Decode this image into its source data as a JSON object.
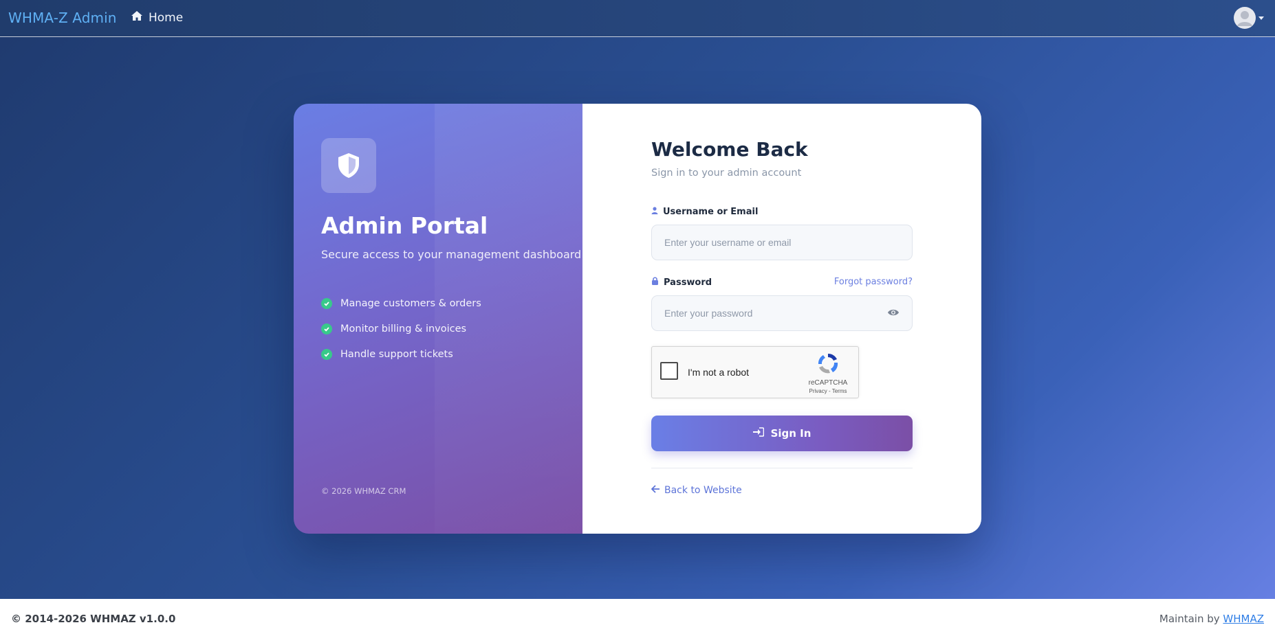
{
  "topnav": {
    "brand": "WHMA-Z Admin",
    "home_label": "Home",
    "home_icon": "home-icon",
    "avatar_icon": "user-avatar-icon"
  },
  "left_panel": {
    "icon": "shield-icon",
    "title": "Admin Portal",
    "subtitle": "Secure access to your management dashboard",
    "features": [
      "Manage customers & orders",
      "Monitor billing & invoices",
      "Handle support tickets"
    ],
    "footer": "© 2026 WHMAZ CRM"
  },
  "login": {
    "title": "Welcome Back",
    "subtitle": "Sign in to your admin account",
    "username_label": "Username or Email",
    "username_placeholder": "Enter your username or email",
    "password_label": "Password",
    "password_placeholder": "Enter your password",
    "forgot_label": "Forgot password?",
    "recaptcha": {
      "label": "I'm not a robot",
      "brand": "reCAPTCHA",
      "links": "Privacy - Terms"
    },
    "signin_label": "Sign In",
    "back_label": "Back to Website"
  },
  "footer": {
    "copyright": "© 2014-2026 WHMAZ v1.0.0",
    "maintain_prefix": "Maintain by",
    "maintain_link": "WHMAZ"
  },
  "colors": {
    "accent": "#6b7fe0",
    "gradient_start": "#6a7fe6",
    "gradient_end": "#7b4fa6",
    "check": "#38c98a"
  }
}
